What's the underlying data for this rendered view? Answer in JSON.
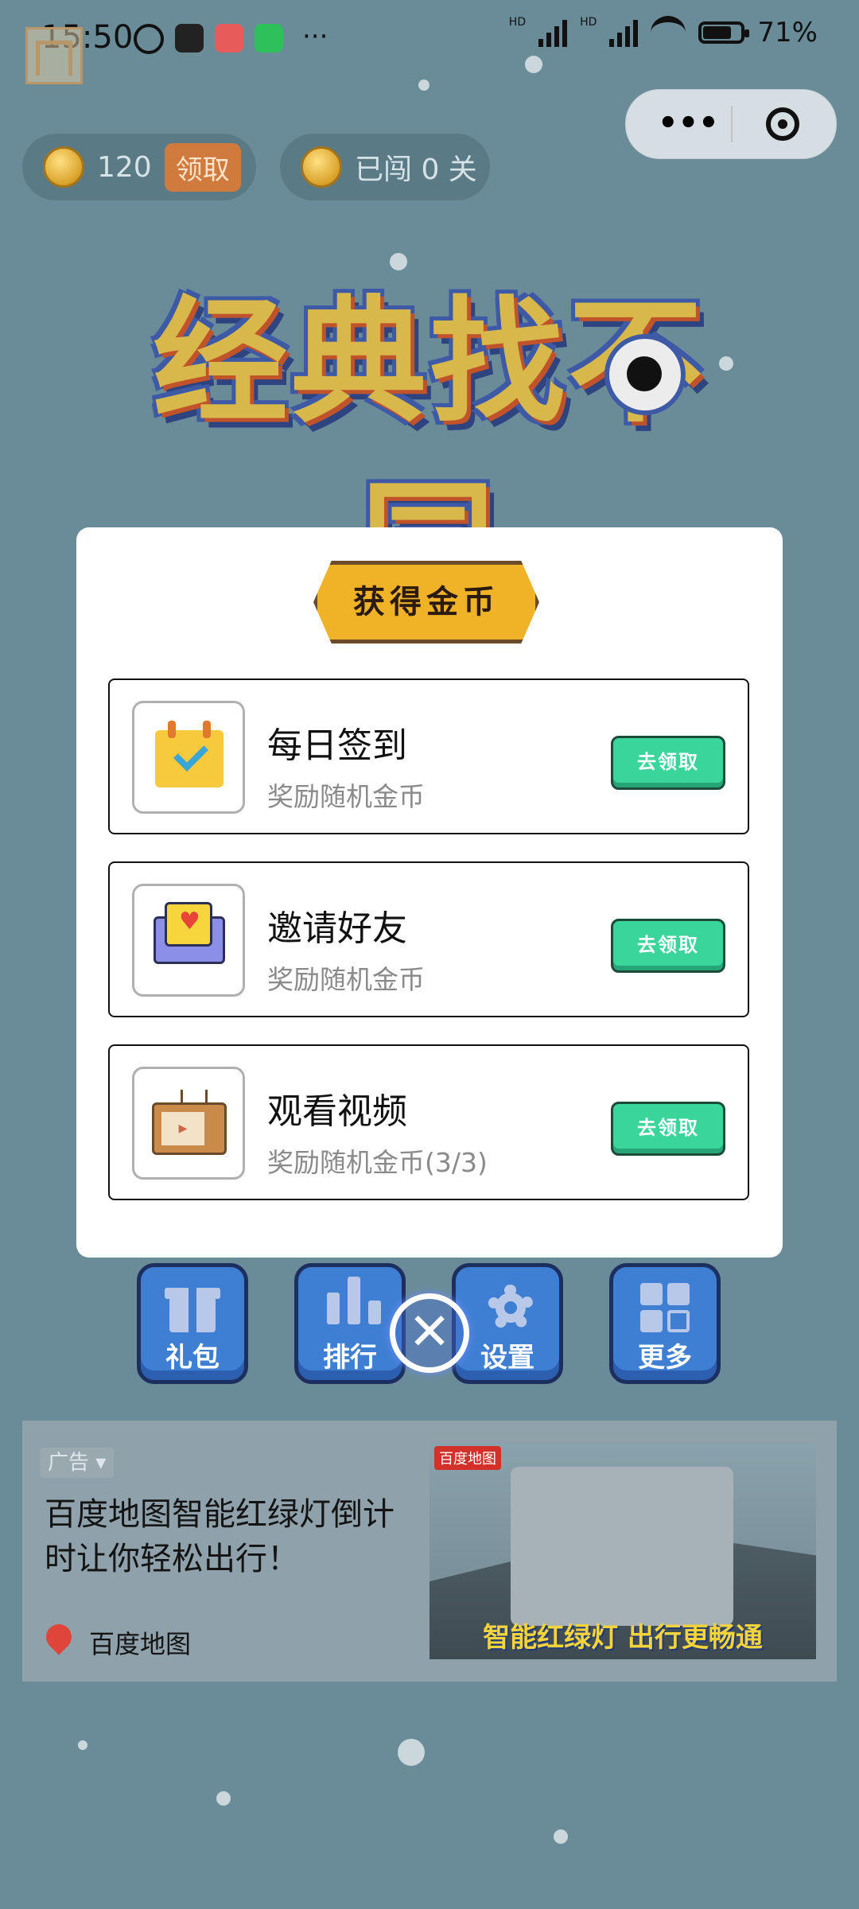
{
  "status_bar": {
    "time": "15:50",
    "battery": "71%",
    "battery_level": 0.71,
    "overflow": "···",
    "network_badges": [
      "HD",
      "HD"
    ]
  },
  "capsule": {
    "more_icon": "more-icon",
    "target_icon": "target-icon"
  },
  "top": {
    "coins_count": "120",
    "claim_label": "领取",
    "levels_label": "已闯 0 关"
  },
  "game_title": "经典找不同",
  "modal": {
    "banner": "获得金币",
    "rows": [
      {
        "icon": "calendar-icon",
        "title": "每日签到",
        "subtitle": "奖励随机金币",
        "button": "去领取"
      },
      {
        "icon": "envelope-icon",
        "title": "邀请好友",
        "subtitle": "奖励随机金币",
        "button": "去领取"
      },
      {
        "icon": "tv-icon",
        "title": "观看视频",
        "subtitle": "奖励随机金币(3/3)",
        "button": "去领取"
      }
    ],
    "close_icon": "close-icon"
  },
  "menu": {
    "items": [
      {
        "label": "礼包",
        "icon": "gift-icon"
      },
      {
        "label": "排行",
        "icon": "ranking-icon"
      },
      {
        "label": "设置",
        "icon": "gear-icon"
      },
      {
        "label": "更多",
        "icon": "grid-icon"
      }
    ]
  },
  "ad": {
    "tag": "广告 ▾",
    "title": "百度地图智能红绿灯倒计时让你轻松出行！",
    "source": "百度地图",
    "image_logo": "百度地图",
    "image_text": "智能红绿灯 出行更畅通"
  },
  "colors": {
    "background": "#6a8c99",
    "button_green": "#3ad59a",
    "menu_blue": "#3f7fd3",
    "banner_gold": "#f0b328"
  }
}
